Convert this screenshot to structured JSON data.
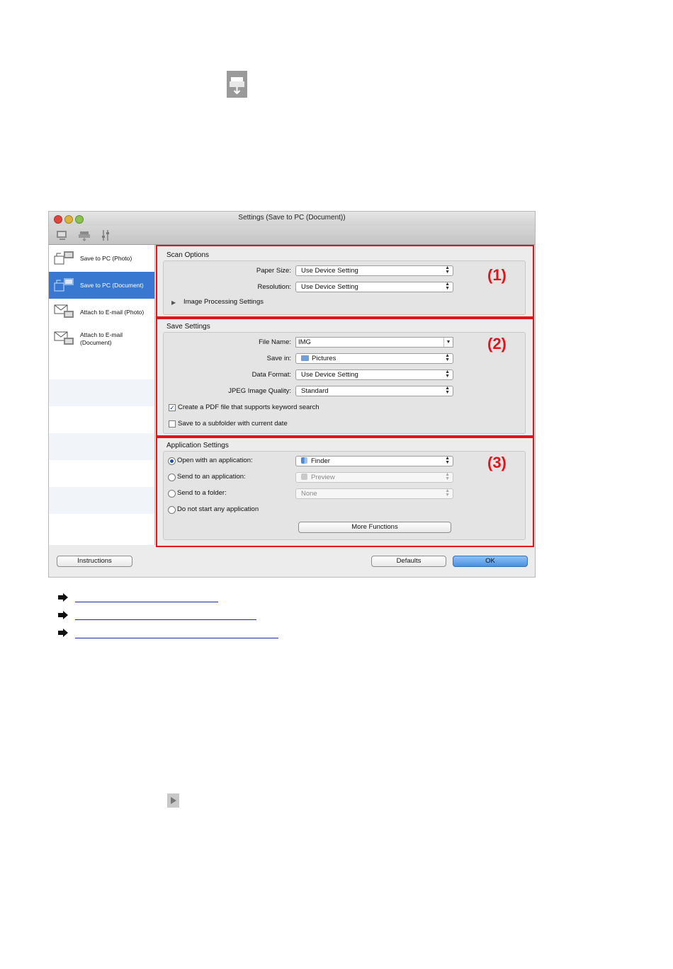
{
  "window": {
    "title": "Settings (Save to PC (Document))"
  },
  "toolbar": {
    "icons": [
      "scan-from-computer-icon",
      "scan-from-operation-panel-icon",
      "general-settings-icon"
    ]
  },
  "sidebar": {
    "items": [
      {
        "label": "Save to PC (Photo)",
        "icon": "save-photo-icon",
        "selected": false
      },
      {
        "label": "Save to PC (Document)",
        "icon": "save-document-icon",
        "selected": true
      },
      {
        "label": "Attach to E-mail (Photo)",
        "icon": "email-photo-icon",
        "selected": false
      },
      {
        "label": "Attach to E-mail (Document)",
        "icon": "email-document-icon",
        "selected": false
      }
    ]
  },
  "scan_options": {
    "title": "Scan Options",
    "paper_size_label": "Paper Size:",
    "paper_size_value": "Use Device Setting",
    "resolution_label": "Resolution:",
    "resolution_value": "Use Device Setting",
    "image_processing_label": "Image Processing Settings",
    "marker": "(1)"
  },
  "save_settings": {
    "title": "Save Settings",
    "file_name_label": "File Name:",
    "file_name_value": "IMG",
    "save_in_label": "Save in:",
    "save_in_value": "Pictures",
    "data_format_label": "Data Format:",
    "data_format_value": "Use Device Setting",
    "jpeg_quality_label": "JPEG Image Quality:",
    "jpeg_quality_value": "Standard",
    "pdf_keyword_label": "Create a PDF file that supports keyword search",
    "pdf_keyword_checked": true,
    "subfolder_label": "Save to a subfolder with current date",
    "subfolder_checked": false,
    "marker": "(2)"
  },
  "application_settings": {
    "title": "Application Settings",
    "open_app_label": "Open with an application:",
    "open_app_value": "Finder",
    "send_app_label": "Send to an application:",
    "send_app_value": "Preview",
    "send_folder_label": "Send to a folder:",
    "send_folder_value": "None",
    "no_app_label": "Do not start any application",
    "selected_option": "open_app",
    "more_functions_label": "More Functions",
    "marker": "(3)"
  },
  "footer": {
    "instructions_label": "Instructions",
    "defaults_label": "Defaults",
    "ok_label": "OK"
  },
  "colors": {
    "highlight": "#e2141b",
    "selection": "#3878d0",
    "link": "#1a2fa0"
  }
}
